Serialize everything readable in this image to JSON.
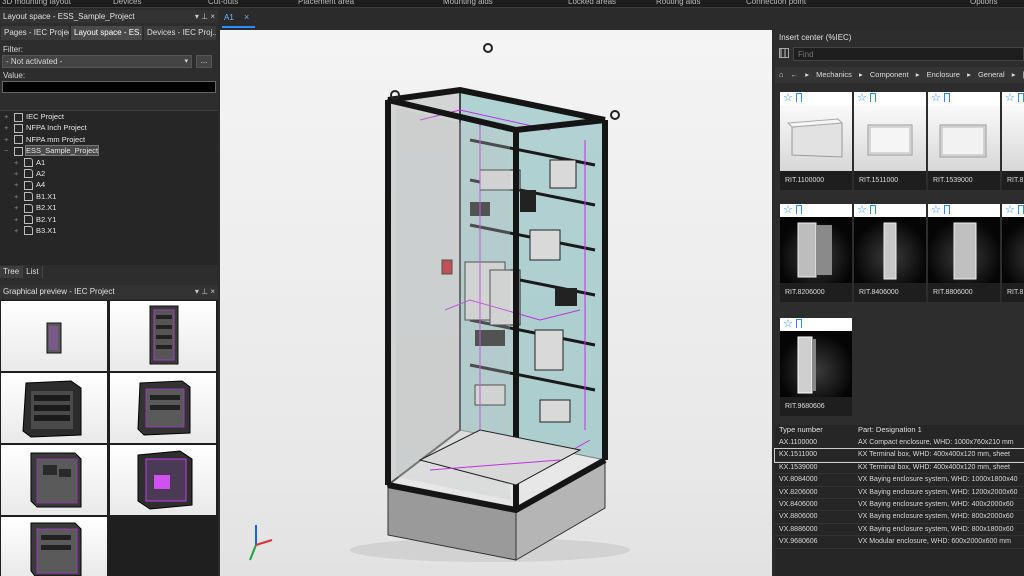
{
  "ribbon": {
    "tabs": [
      "3D mounting layout",
      "Devices",
      "Cut-outs",
      "Placement area",
      "Mounting aids",
      "Locked areas",
      "Routing aids",
      "Connection point",
      "Options"
    ]
  },
  "layout_space": {
    "title": "Layout space - ESS_Sample_Project",
    "buttons": "▾ ⊥ ×",
    "tabs": [
      "Pages - IEC Project",
      "Layout space - ES...",
      "Devices - IEC Proj..."
    ],
    "filter_label": "Filter:",
    "filter_value": "- Not activated -",
    "filter_more": "...",
    "value_label": "Value:",
    "tree": [
      {
        "label": "IEC Project",
        "level": 0,
        "expander": "+",
        "icon": "project"
      },
      {
        "label": "NFPA Inch Project",
        "level": 0,
        "expander": "+",
        "icon": "project"
      },
      {
        "label": "NFPA mm Project",
        "level": 0,
        "expander": "+",
        "icon": "project"
      },
      {
        "label": "ESS_Sample_Project",
        "level": 0,
        "expander": "−",
        "icon": "project",
        "selected": true
      },
      {
        "label": "A1",
        "level": 1,
        "expander": "+",
        "icon": "page"
      },
      {
        "label": "A2",
        "level": 1,
        "expander": "+",
        "icon": "page"
      },
      {
        "label": "A4",
        "level": 1,
        "expander": "+",
        "icon": "page"
      },
      {
        "label": "B1.X1",
        "level": 1,
        "expander": "+",
        "icon": "page"
      },
      {
        "label": "B2.X1",
        "level": 1,
        "expander": "+",
        "icon": "page"
      },
      {
        "label": "B2.Y1",
        "level": 1,
        "expander": "+",
        "icon": "page"
      },
      {
        "label": "B3.X1",
        "level": 1,
        "expander": "+",
        "icon": "page"
      }
    ],
    "bottom_tabs": [
      "Tree",
      "List"
    ]
  },
  "graphical_preview": {
    "title": "Graphical preview - IEC Project",
    "buttons": "▾ ⊥ ×"
  },
  "document": {
    "tab_label": "A1",
    "close_label": "×"
  },
  "insert_center": {
    "title": "Insert center (%IEC)",
    "find_placeholder": "Find",
    "breadcrumb": [
      "Mechanics",
      "Component",
      "Enclosure",
      "General"
    ],
    "home_icon": "⌂",
    "back_icon": "←",
    "sep_icon": "▸",
    "more_icon": "|◂",
    "cards": [
      {
        "label": "RIT.1100000",
        "style": "light"
      },
      {
        "label": "RIT.1511000",
        "style": "light"
      },
      {
        "label": "RIT.1539000",
        "style": "light"
      },
      {
        "label": "RIT.8",
        "style": "light"
      },
      {
        "label": "RIT.8206000",
        "style": "dark"
      },
      {
        "label": "RIT.8406000",
        "style": "dark"
      },
      {
        "label": "RIT.8806000",
        "style": "dark"
      },
      {
        "label": "RIT.8",
        "style": "dark"
      },
      {
        "label": "RIT.9680606",
        "style": "dark"
      }
    ],
    "parts_columns": [
      "Type number",
      "Part: Designation 1"
    ],
    "parts": [
      {
        "type": "AX.1100000",
        "designation": "AX Compact enclosure, WHD: 1000x760x210 mm"
      },
      {
        "type": "KX.1511000",
        "designation": "KX Terminal box, WHD: 400x400x120 mm, sheet",
        "selected": true
      },
      {
        "type": "KX.1539000",
        "designation": "KX Terminal box, WHD: 400x400x120 mm, sheet"
      },
      {
        "type": "VX.8084000",
        "designation": "VX Baying enclosure system, WHD: 1000x1800x40"
      },
      {
        "type": "VX.8206000",
        "designation": "VX Baying enclosure system, WHD: 1200x2000x60"
      },
      {
        "type": "VX.8406000",
        "designation": "VX Baying enclosure system, WHD: 400x2000x60"
      },
      {
        "type": "VX.8806000",
        "designation": "VX Baying enclosure system, WHD: 800x2000x60"
      },
      {
        "type": "VX.8886000",
        "designation": "VX Baying enclosure system, WHD: 800x1800x60"
      },
      {
        "type": "VX.9680606",
        "designation": "VX Modular enclosure, WHD: 600x2000x600 mm"
      }
    ]
  }
}
